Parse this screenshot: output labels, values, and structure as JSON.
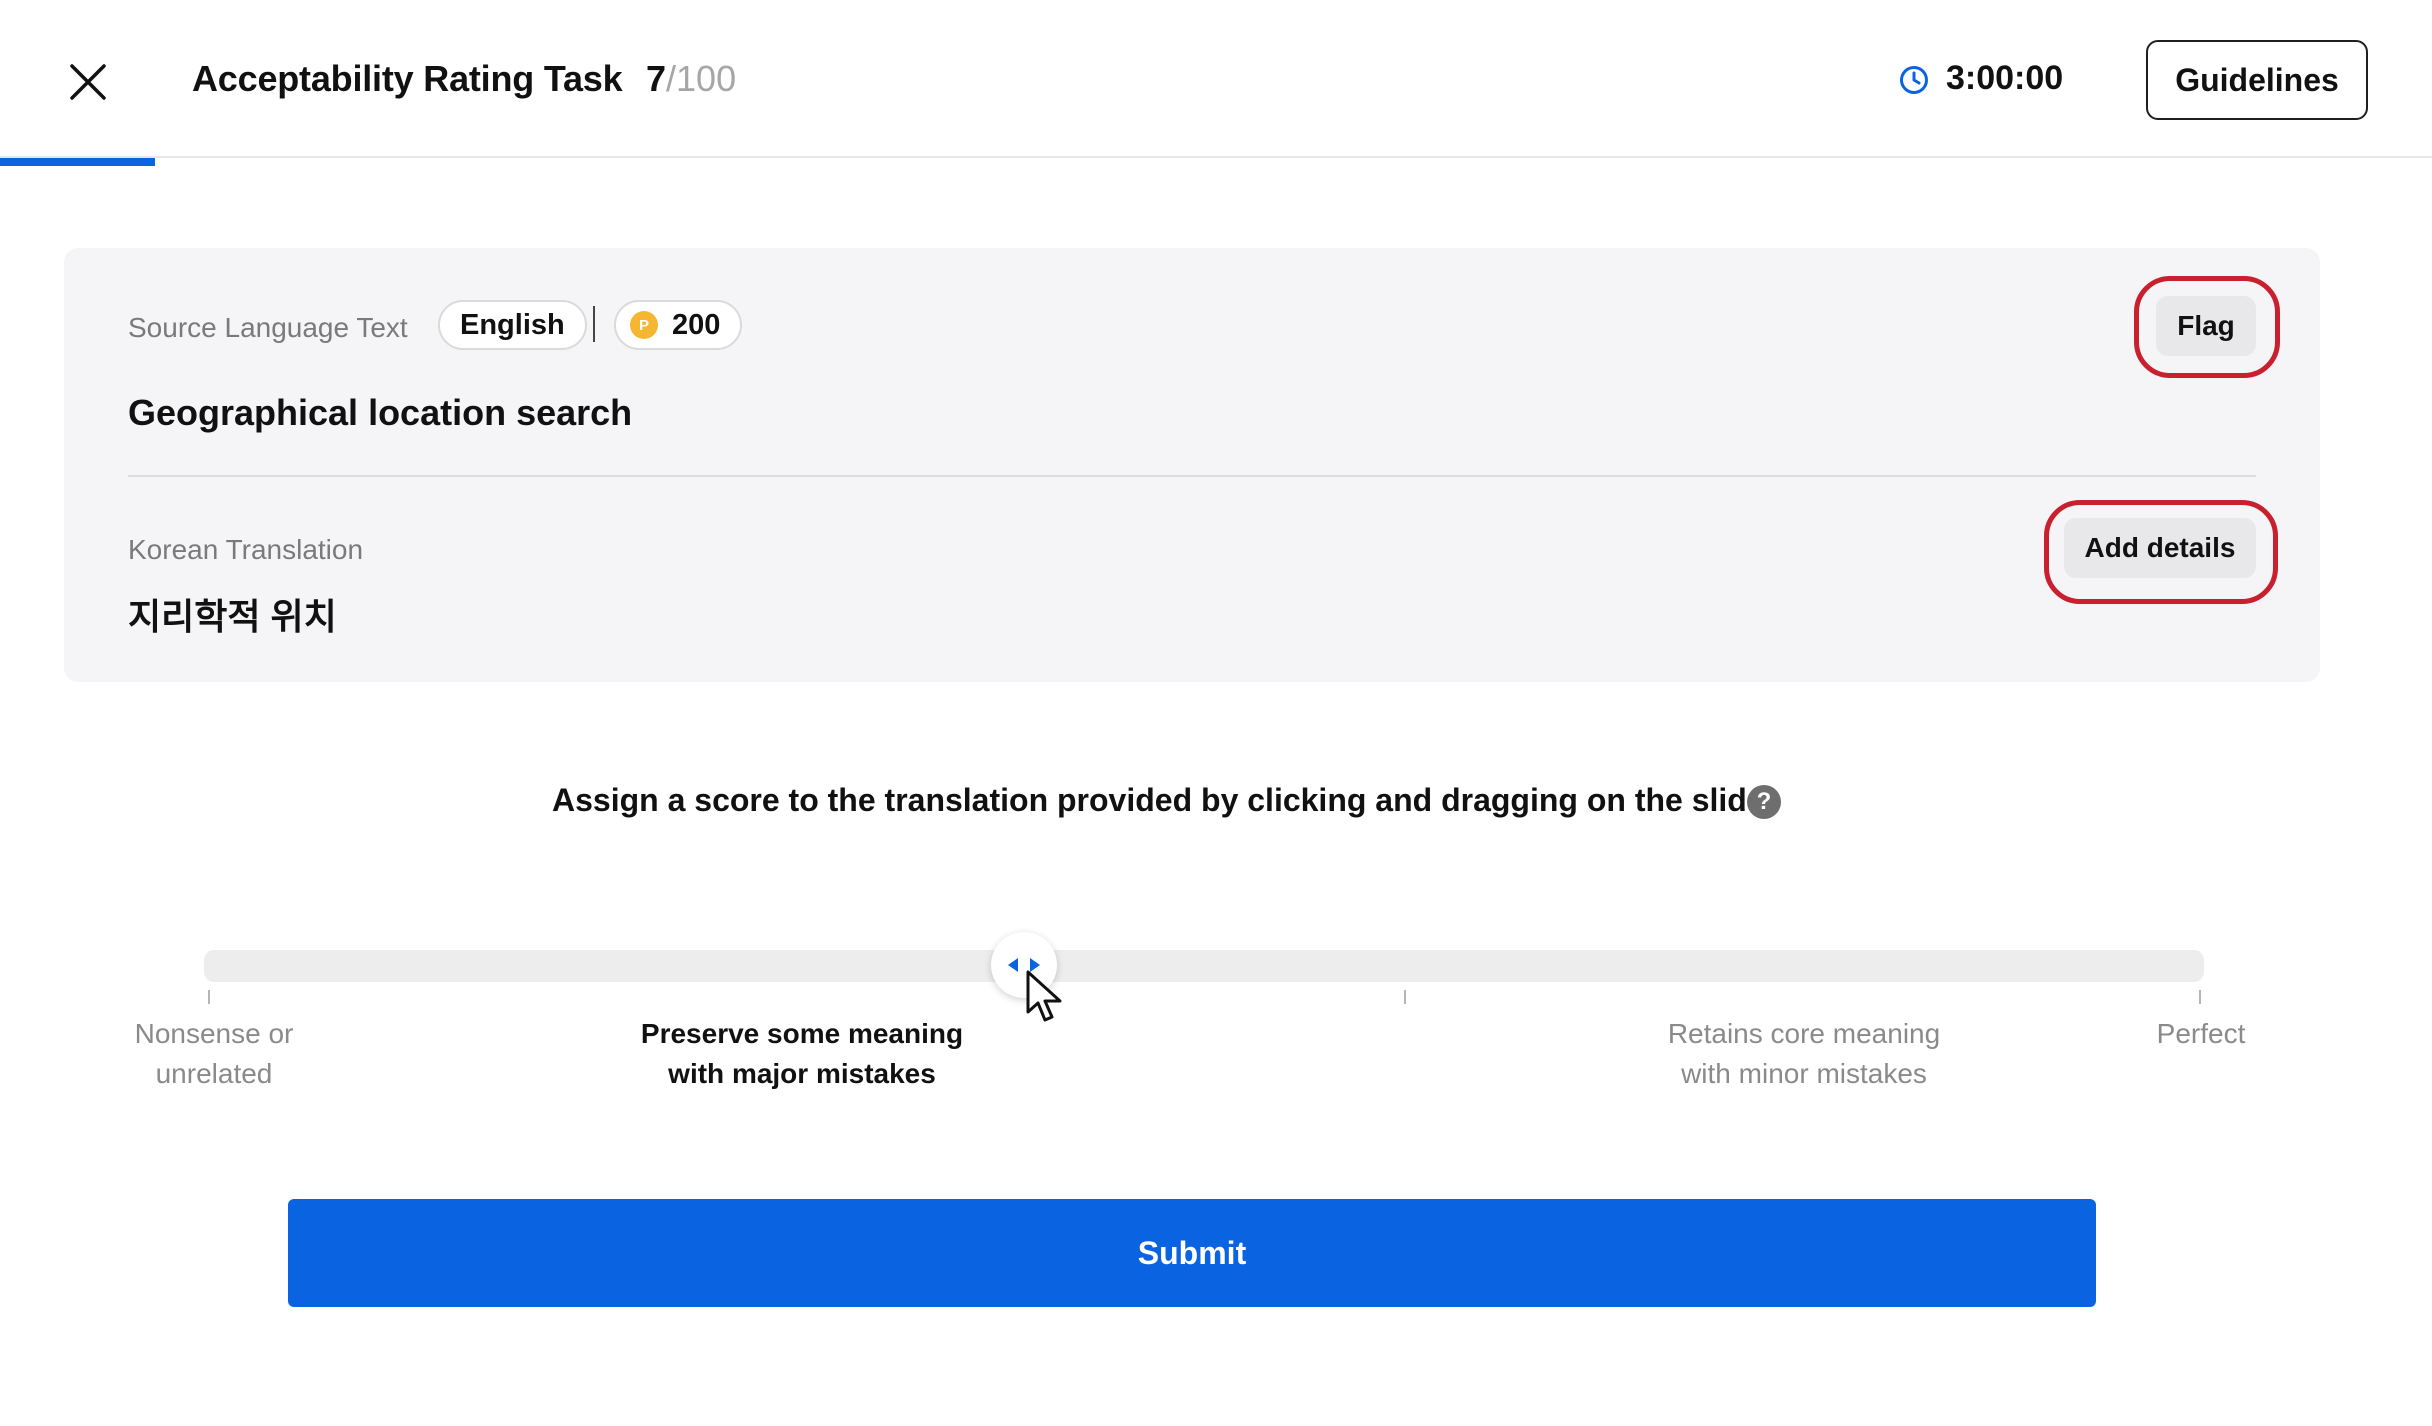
{
  "header": {
    "title": "Acceptability Rating Task",
    "progress": {
      "current": "7",
      "total": "/100",
      "fraction": 0.07
    },
    "timer": "3:00:00",
    "guidelines_label": "Guidelines"
  },
  "source": {
    "label": "Source Language Text",
    "language": "English",
    "points": "200",
    "coin_glyph": "P",
    "text": "Geographical location search",
    "flag_label": "Flag"
  },
  "translation": {
    "label": "Korean Translation",
    "text": "지리학적 위치",
    "details_label": "Add details"
  },
  "rating": {
    "instruction": "Assign a score to the translation provided by clicking and dragging on the slider",
    "help_glyph": "?",
    "slider_value": 0.41,
    "scale_labels": [
      {
        "line1": "Nonsense or",
        "line2": "unrelated"
      },
      {
        "line1": "Preserve some meaning",
        "line2": "with major mistakes"
      },
      {
        "line1": "Retains core meaning",
        "line2": "with minor mistakes"
      },
      {
        "line1": "Perfect",
        "line2": ""
      }
    ]
  },
  "submit_label": "Submit",
  "colors": {
    "accent": "#0a63e0",
    "highlight": "#c8202f",
    "coin": "#f5b731"
  },
  "icons": [
    "close-icon",
    "clock-icon",
    "coin-icon",
    "help-icon",
    "slider-arrows-icon",
    "cursor-arrow-icon"
  ]
}
